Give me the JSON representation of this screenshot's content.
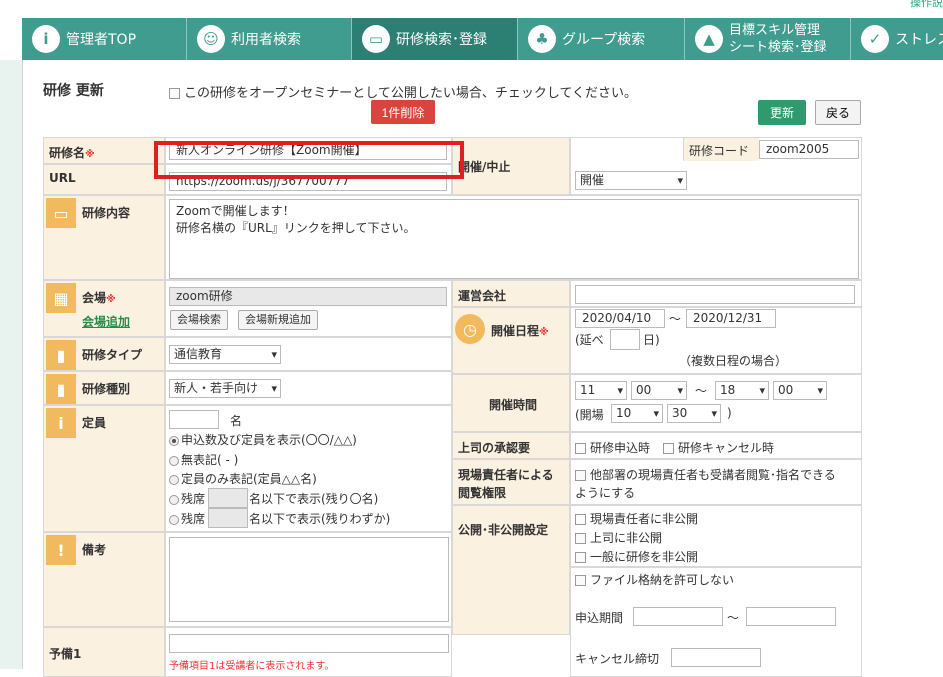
{
  "help_link": "操作説",
  "nav": {
    "tabs": [
      {
        "label": "管理者TOP",
        "icon": "info-icon",
        "glyph": "i"
      },
      {
        "label": "利用者検索",
        "icon": "user-search-icon",
        "glyph": "☺"
      },
      {
        "label": "研修検索･登録",
        "icon": "screen-icon",
        "glyph": "▭"
      },
      {
        "label": "グループ検索",
        "icon": "group-icon",
        "glyph": "♣"
      },
      {
        "label1": "目標スキル管理",
        "label2": "シート検索･登録",
        "icon": "chart-icon",
        "glyph": "▲"
      },
      {
        "label": "ストレス",
        "icon": "check-icon",
        "glyph": "✓"
      }
    ]
  },
  "page_title": "研修 更新",
  "open_seminar_label": "この研修をオープンセミナーとして公開したい場合、チェックしてください。",
  "delete_button": "1件削除",
  "update_button": "更新",
  "back_button": "戻る",
  "form": {
    "name_label": "研修名",
    "required_mark": "※",
    "name_value": "新人オンライン研修【Zoom開催】",
    "url_label": "URL",
    "url_value": "https://zoom.us/j/367700777",
    "status_label": "開催/中止",
    "code_label": "研修コード",
    "code_value": "zoom2005",
    "status_value": "開催",
    "content_label": "研修内容",
    "content_line1": "Zoomで開催します！",
    "content_line2": "研修名横の『URL』リンクを押して下さい。",
    "venue_label": "会場",
    "venue_add_link": "会場追加",
    "venue_value": "zoom研修",
    "venue_search_btn": "会場検索",
    "venue_new_btn": "会場新規追加",
    "operator_label": "運営会社",
    "operator_value": "",
    "date_label": "開催日程",
    "date_from": "2020/04/10",
    "tilde": "～",
    "date_to": "2020/12/31",
    "extend_prefix": "(延べ",
    "extend_suffix": "日)",
    "multi_note": "（複数日程の場合）",
    "time_label": "開催時間",
    "start_hour": "11",
    "start_min": "00",
    "end_hour": "18",
    "end_min": "00",
    "door_prefix": "(開場",
    "door_hour": "10",
    "door_min": "30",
    "door_suffix": ")",
    "type_label": "研修タイプ",
    "type_value": "通信教育",
    "kind_label": "研修種別",
    "kind_value": "新人・若手向け",
    "capacity_label": "定員",
    "capacity_unit": "名",
    "capacity_options": [
      "申込数及び定員を表示(〇〇/△△)",
      "無表記( - )",
      "定員のみ表記(定員△△名)"
    ],
    "remain_prefix": "残席",
    "remain_opt1_suffix": "名以下で表示(残り〇名)",
    "remain_opt2_suffix": "名以下で表示(残りわずか)",
    "approval_label": "上司の承認要",
    "approval_opt1": "研修申込時",
    "approval_opt2": "研修キャンセル時",
    "viewer_label_line1": "現場責任者による",
    "viewer_label_line2": "閲覧権限",
    "viewer_text_line1": "他部署の現場責任者も受講者閲覧･指名できる",
    "viewer_text_line2": "ようにする",
    "remarks_label": "備考",
    "public_label": "公開･非公開設定",
    "public_opts": [
      "現場責任者に非公開",
      "上司に非公開",
      "一般に研修を非公開"
    ],
    "file_label": "ファイル格納を許可しない",
    "apply_period_label": "申込期間",
    "cancel_deadline_label": "キャンセル締切",
    "spare1_label": "予備1",
    "spare1_note": "予備項目1は受講者に表示されます。"
  }
}
